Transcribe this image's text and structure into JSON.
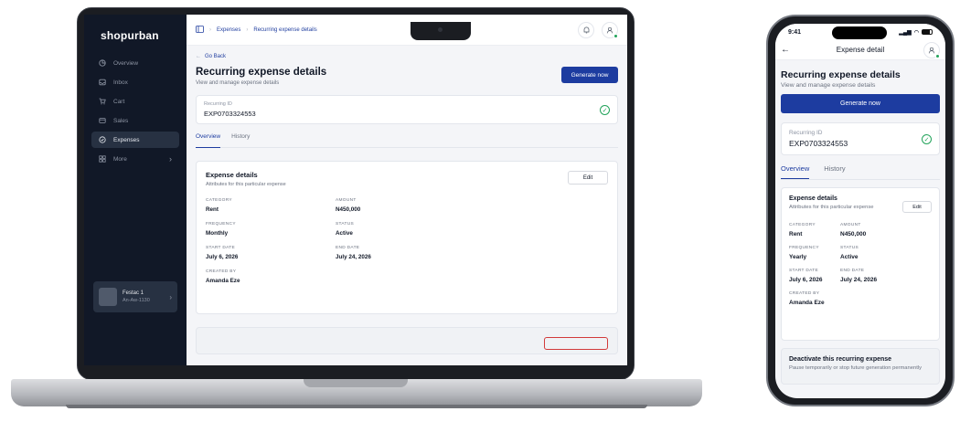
{
  "laptop": {
    "brand": "shopurban",
    "nav": [
      {
        "label": "Overview",
        "icon": "pie-chart-icon"
      },
      {
        "label": "Inbox",
        "icon": "inbox-icon"
      },
      {
        "label": "Cart",
        "icon": "cart-icon"
      },
      {
        "label": "Sales",
        "icon": "sales-icon"
      },
      {
        "label": "Expenses",
        "icon": "expenses-icon"
      },
      {
        "label": "More",
        "icon": "grid-icon"
      }
    ],
    "store": {
      "name": "Festac 1",
      "code": "An-Aw-1130"
    },
    "breadcrumbs": [
      "Expenses",
      "Recurring expense details"
    ],
    "go_back": "Go Back",
    "title": "Recurring expense details",
    "subtitle": "View and manage expense details",
    "generate_label": "Generate now",
    "recurring_id_label": "Recurring ID",
    "recurring_id": "EXP0703324553",
    "tabs": [
      "Overview",
      "History"
    ],
    "details": {
      "title": "Expense details",
      "subtitle": "Attributes for this particular expense",
      "edit_label": "Edit",
      "fields": [
        {
          "label": "CATEGORY",
          "value": "Rent"
        },
        {
          "label": "AMOUNT",
          "value": "N450,000"
        },
        {
          "label": "FREQUENCY",
          "value": "Monthly"
        },
        {
          "label": "STATUS",
          "value": "Active"
        },
        {
          "label": "START DATE",
          "value": "July 6, 2026"
        },
        {
          "label": "END DATE",
          "value": "July 24, 2026"
        },
        {
          "label": "CREATED BY",
          "value": "Amanda Eze"
        }
      ]
    }
  },
  "phone": {
    "time": "9:41",
    "nav_title": "Expense detail",
    "title": "Recurring expense details",
    "subtitle": "View and manage expense details",
    "generate_label": "Generate now",
    "recurring_id_label": "Recurring ID",
    "recurring_id": "EXP0703324553",
    "tabs": [
      "Overview",
      "History"
    ],
    "details": {
      "title": "Expense details",
      "subtitle": "Attributes for this particular expense",
      "edit_label": "Edit",
      "fields": [
        {
          "label": "CATEGORY",
          "value": "Rent"
        },
        {
          "label": "AMOUNT",
          "value": "N450,000"
        },
        {
          "label": "FREQUENCY",
          "value": "Yearly"
        },
        {
          "label": "STATUS",
          "value": "Active"
        },
        {
          "label": "START DATE",
          "value": "July 6, 2026"
        },
        {
          "label": "END DATE",
          "value": "July 24, 2026"
        },
        {
          "label": "CREATED BY",
          "value": "Amanda Eze"
        }
      ]
    },
    "deactivate": {
      "title": "Deactivate this recurring expense",
      "subtitle": "Pause temporarily or stop future generation permanently"
    }
  },
  "colors": {
    "primary": "#1d3ca0",
    "sidebar": "#111827",
    "success": "#22a35a",
    "danger": "#d23a3a"
  }
}
